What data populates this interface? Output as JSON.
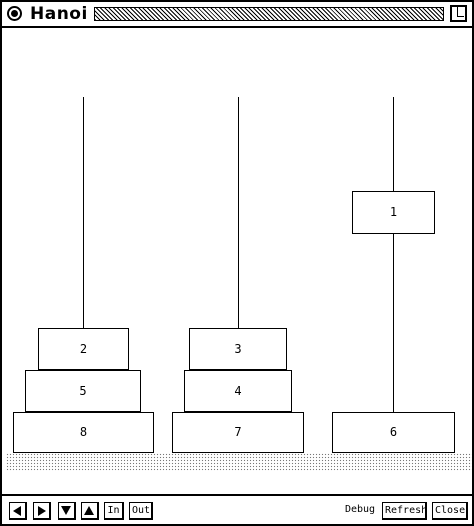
{
  "window": {
    "title": "Hanoi"
  },
  "disks": [
    {
      "label": "2"
    },
    {
      "label": "5"
    },
    {
      "label": "8"
    },
    {
      "label": "3"
    },
    {
      "label": "4"
    },
    {
      "label": "7"
    },
    {
      "label": "1"
    },
    {
      "label": "6"
    }
  ],
  "toolbar": {
    "icons": [
      "left-arrow-icon",
      "right-arrow-icon",
      "down-arrow-icon",
      "up-arrow-icon"
    ],
    "in_label": "In",
    "out_label": "Out",
    "debug_label": "Debug",
    "refresh_label": "Refresh",
    "close_label": "Close"
  }
}
